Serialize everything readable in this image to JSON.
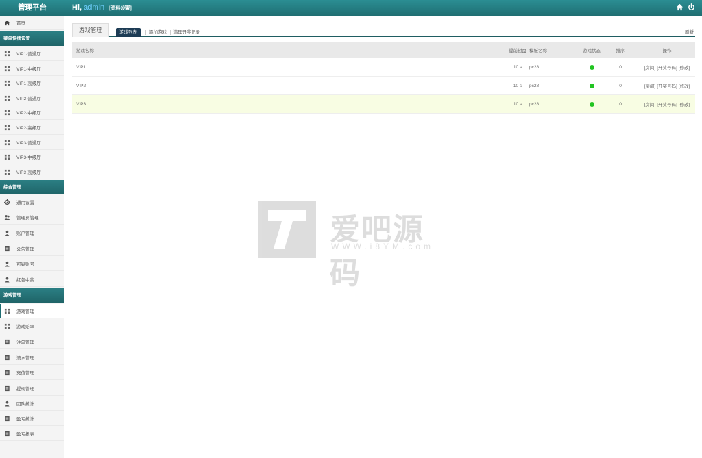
{
  "header": {
    "brand": "管理平台",
    "greeting_prefix": "Hi,",
    "username": "admin",
    "profile_link": "[资料设置]",
    "icons": [
      "home-icon",
      "power-icon"
    ]
  },
  "sidebar": {
    "home": "首页",
    "section_1": "菜单快捷设置",
    "section_1_items": [
      "VIP1-普通厅",
      "VIP1-中级厅",
      "VIP1-高级厅",
      "VIP2-普通厅",
      "VIP2-中级厅",
      "VIP2-高级厅",
      "VIP3-普通厅",
      "VIP3-中级厅",
      "VIP3-高级厅"
    ],
    "section_2": "综合管理",
    "section_2_items": [
      "通用设置",
      "管理员管理",
      "账户管理",
      "公告管理",
      "可疑账号",
      "红包中奖"
    ],
    "section_3": "游戏管理",
    "section_3_items": [
      "游戏管理",
      "游戏赔率",
      "注单管理",
      "流水管理",
      "充值管理",
      "提现管理",
      "团队统计",
      "盈亏统计",
      "盈亏报表"
    ],
    "active_item": "游戏管理"
  },
  "main": {
    "page_tab": "游戏管理",
    "subtabs": [
      "游戏列表",
      "添加游戏",
      "清理开奖记录"
    ],
    "refresh": "刷新",
    "columns": [
      "游戏名称",
      "提前封盘",
      "模板名称",
      "游戏状态",
      "排序",
      "操作"
    ],
    "rows": [
      {
        "name": "VIP1",
        "close_before": "10 s",
        "template": "pc28",
        "status": "on",
        "sort": "0",
        "ops": [
          "[房间]",
          "[开奖号码]",
          "[修改]"
        ]
      },
      {
        "name": "VIP2",
        "close_before": "10 s",
        "template": "pc28",
        "status": "on",
        "sort": "0",
        "ops": [
          "[房间]",
          "[开奖号码]",
          "[修改]"
        ]
      },
      {
        "name": "VIP3",
        "close_before": "10 s",
        "template": "pc28",
        "status": "on",
        "sort": "0",
        "ops": [
          "[房间]",
          "[开奖号码]",
          "[修改]"
        ]
      }
    ],
    "status_color": "#22c422"
  },
  "watermark": {
    "title": "爱吧源码",
    "url": "WWW.i8YM.com"
  },
  "colors": {
    "header_bg": "#1f6e72",
    "active_subtab": "#1d3c55",
    "highlight_row": "#f8fde3"
  }
}
